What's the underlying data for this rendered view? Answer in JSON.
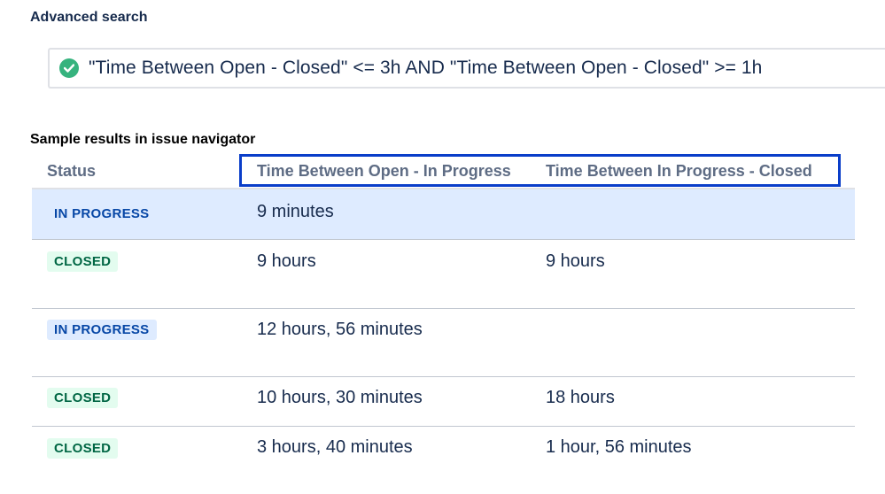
{
  "advanced_search": {
    "title": "Advanced search",
    "query": "\"Time Between Open - Closed\" <= 3h AND \"Time Between Open - Closed\" >= 1h",
    "status_icon": "check-circle-icon"
  },
  "results": {
    "title": "Sample results in issue navigator",
    "columns": {
      "status": "Status",
      "open_in_progress": "Time Between Open - In Progress",
      "in_progress_closed": "Time Between In Progress - Closed"
    },
    "rows": [
      {
        "status": "IN PROGRESS",
        "open_in_progress": "9 minutes",
        "in_progress_closed": ""
      },
      {
        "status": "CLOSED",
        "open_in_progress": "9 hours",
        "in_progress_closed": "9 hours"
      },
      {
        "status": "IN PROGRESS",
        "open_in_progress": "12 hours, 56 minutes",
        "in_progress_closed": ""
      },
      {
        "status": "CLOSED",
        "open_in_progress": "10 hours, 30 minutes",
        "in_progress_closed": "18 hours"
      },
      {
        "status": "CLOSED",
        "open_in_progress": "3 hours, 40 minutes",
        "in_progress_closed": "1 hour, 56 minutes"
      }
    ]
  },
  "colors": {
    "highlight_border": "#0a3ec9",
    "check_green": "#36b37e",
    "in_progress_text": "#0747a6",
    "closed_text": "#006644",
    "selected_row": "#deebff"
  }
}
